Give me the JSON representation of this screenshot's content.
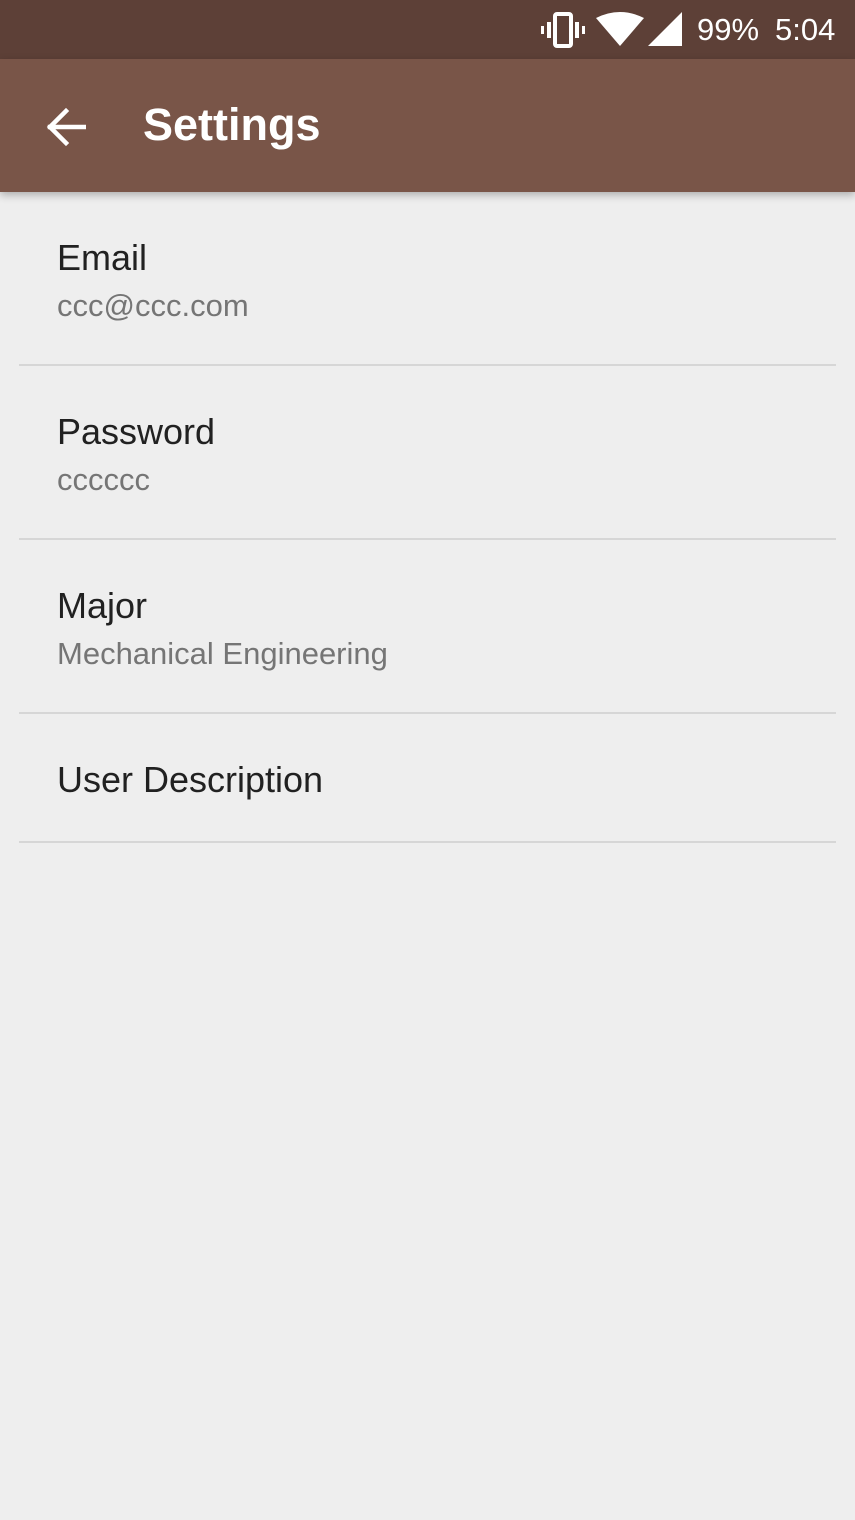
{
  "status_bar": {
    "battery": "99%",
    "time": "5:04",
    "icons": [
      "vibrate-icon",
      "wifi-icon",
      "cell-signal-icon"
    ]
  },
  "app_bar": {
    "title": "Settings",
    "back_icon": "arrow-back-icon"
  },
  "preferences": [
    {
      "title": "Email",
      "summary": "ccc@ccc.com"
    },
    {
      "title": "Password",
      "summary": "cccccc"
    },
    {
      "title": "Major",
      "summary": "Mechanical Engineering"
    },
    {
      "title": "User Description"
    }
  ],
  "colors": {
    "status_bar": "#5d4037",
    "app_bar": "#795548",
    "background": "#eeeeee",
    "title_text": "#212121",
    "summary_text": "#757575",
    "divider": "#d6d6d6"
  }
}
